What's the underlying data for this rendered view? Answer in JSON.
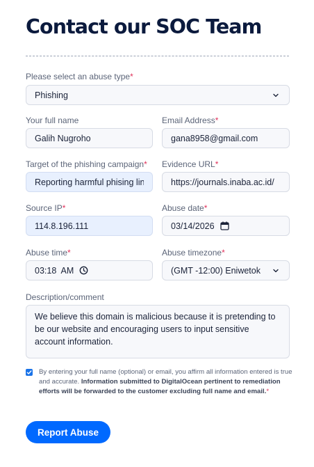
{
  "page": {
    "title": "Contact our SOC Team"
  },
  "form": {
    "abuse_type": {
      "label": "Please select an abuse type",
      "required_mark": "*",
      "value": "Phishing",
      "icon": "chevron-down-icon"
    },
    "full_name": {
      "label": "Your full name",
      "value": "Galih Nugroho"
    },
    "email": {
      "label": "Email Address",
      "required_mark": "*",
      "value": "gana8958@gmail.com"
    },
    "target": {
      "label": "Target of the phishing campaign",
      "required_mark": "*",
      "value": "Reporting harmful phising link"
    },
    "evidence_url": {
      "label": "Evidence URL",
      "required_mark": "*",
      "value": "https://journals.inaba.ac.id/"
    },
    "source_ip": {
      "label": "Source IP",
      "required_mark": "*",
      "value": "114.8.196.111"
    },
    "abuse_date": {
      "label": "Abuse date",
      "required_mark": "*",
      "value": "03/14/2026",
      "icon": "calendar-icon"
    },
    "abuse_time": {
      "label": "Abuse time",
      "required_mark": "*",
      "value": "03:18  AM",
      "icon": "clock-icon"
    },
    "abuse_timezone": {
      "label": "Abuse timezone",
      "required_mark": "*",
      "value": "(GMT -12:00) Eniwetok",
      "icon": "chevron-down-icon"
    },
    "description": {
      "label": "Description/comment",
      "value": "We believe this domain is malicious because it is pretending to be our website and encouraging users to input sensitive account information."
    },
    "consent": {
      "checked": true,
      "text_plain": "By entering your full name (optional) or email, you affirm all information entered is true and accurate. ",
      "text_bold": "Information submitted to DigitalOcean pertinent to remediation efforts will be forwarded to the customer excluding full name and email.",
      "required_mark": "*"
    },
    "submit_label": "Report Abuse"
  },
  "colors": {
    "accent": "#0069ff",
    "required": "#e0315a",
    "title": "#0b1a3d",
    "autofill_bg": "#e8f0fe"
  }
}
